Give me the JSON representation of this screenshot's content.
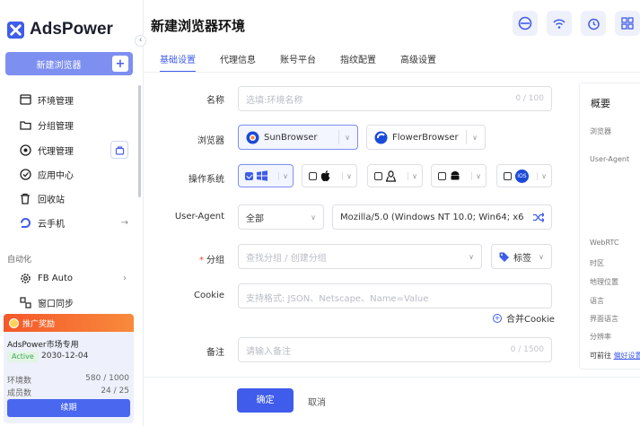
{
  "app": {
    "name": "AdsPower",
    "brand_color": "#3f5cea"
  },
  "sidebar": {
    "collapse_icon": "chevron-left-icon",
    "new_browser_label": "新建浏览器",
    "menu": [
      {
        "label": "环境管理",
        "icon": "window-icon"
      },
      {
        "label": "分组管理",
        "icon": "folder-icon"
      },
      {
        "label": "代理管理",
        "icon": "proxy-icon"
      },
      {
        "label": "应用中心",
        "icon": "app-icon"
      },
      {
        "label": "回收站",
        "icon": "trash-icon"
      },
      {
        "label": "云手机",
        "icon": "cloud-phone-icon",
        "suffix": "→"
      }
    ],
    "automation_label": "自动化",
    "automation": [
      {
        "label": "FB Auto",
        "icon": "gear-icon",
        "suffix": "›"
      },
      {
        "label": "窗口同步",
        "icon": "sync-icon"
      }
    ],
    "promo": {
      "header": "推广奖励",
      "title": "AdsPower市场专用",
      "status": "Active",
      "date": "2030-12-04",
      "env_label": "环境数",
      "env_value": "580 / 1000",
      "member_label": "成员数",
      "member_value": "24 / 25",
      "renew_label": "续期"
    }
  },
  "main": {
    "title": "新建浏览器环境",
    "top_icons": [
      "network-icon",
      "wifi-icon",
      "timer-icon",
      "grid-icon"
    ],
    "tabs": [
      {
        "label": "基础设置",
        "active": true
      },
      {
        "label": "代理信息"
      },
      {
        "label": "账号平台"
      },
      {
        "label": "指纹配置"
      },
      {
        "label": "高级设置"
      }
    ],
    "form": {
      "name_label": "名称",
      "name_placeholder": "选填:环境名称",
      "name_counter": "0 / 100",
      "browser_label": "浏览器",
      "browser_options": [
        "SunBrowser",
        "FlowerBrowser"
      ],
      "os_label": "操作系统",
      "os_options": [
        "windows",
        "mac",
        "linux",
        "android",
        "ios"
      ],
      "ios_text": "iOS",
      "ua_label": "User-Agent",
      "ua_mode": "全部",
      "ua_value": "Mozilla/5.0 (Windows NT 10.0; Win64; x6...",
      "group_label": "分组",
      "group_placeholder": "查找分组 / 创建分组",
      "tag_label": "标签",
      "cookie_label": "Cookie",
      "cookie_placeholder": "支持格式: JSON、Netscape、Name=Value",
      "merge_cookie_label": "合并Cookie",
      "note_label": "备注",
      "note_placeholder": "请输入备注",
      "note_counter": "0 / 1500"
    },
    "footer": {
      "ok_label": "确定",
      "cancel_label": "取消"
    },
    "summary": {
      "title": "概要",
      "items": [
        "浏览器",
        "User-Agent",
        "WebRTC",
        "时区",
        "地理位置",
        "语言",
        "界面语言",
        "分辨率"
      ],
      "goto_label": "可前往",
      "goto_link": "偏好设置"
    }
  }
}
